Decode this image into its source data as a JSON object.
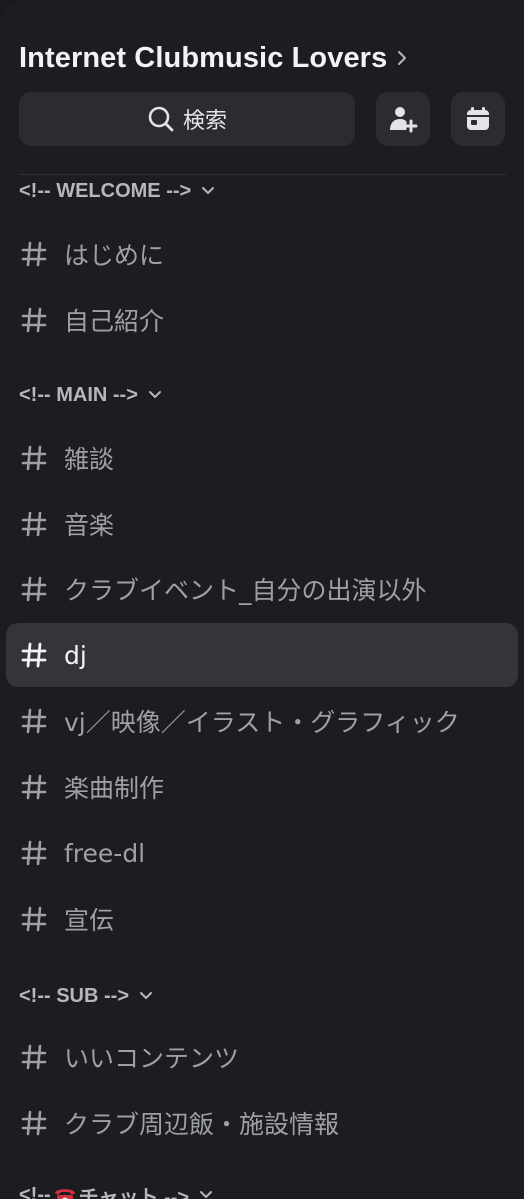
{
  "server": {
    "name": "Internet Clubmusic Lovers"
  },
  "toolbar": {
    "search_label": "検索",
    "search_icon": "search-icon",
    "invite_icon": "add-member-icon",
    "events_icon": "calendar-icon"
  },
  "colors": {
    "background": "#1c1c21",
    "button_bg": "#2b2c31",
    "selected_bg": "#34353b",
    "channel_text": "#9ea0a8",
    "selected_text": "#f2f3f5",
    "category_text": "#b5b7bd"
  },
  "categories": [
    {
      "label": "<!-- WELCOME -->"
    },
    {
      "label": "<!-- MAIN -->"
    },
    {
      "label": "<!-- SUB -->"
    },
    {
      "label_prefix": "<!-- ",
      "emoji_icon": "telephone-emoji",
      "label_suffix": "チャット -->"
    }
  ],
  "channels": [
    {
      "name": "はじめに"
    },
    {
      "name": "自己紹介"
    },
    {
      "name": "雑談"
    },
    {
      "name": "音楽"
    },
    {
      "name": "クラブイベント_自分の出演以外"
    },
    {
      "name": "dj",
      "selected": true
    },
    {
      "name": "vj／映像／イラスト・グラフィック"
    },
    {
      "name": "楽曲制作"
    },
    {
      "name": "free-dl"
    },
    {
      "name": "宣伝"
    },
    {
      "name": "いいコンテンツ"
    },
    {
      "name": "クラブ周辺飯・施設情報"
    }
  ]
}
